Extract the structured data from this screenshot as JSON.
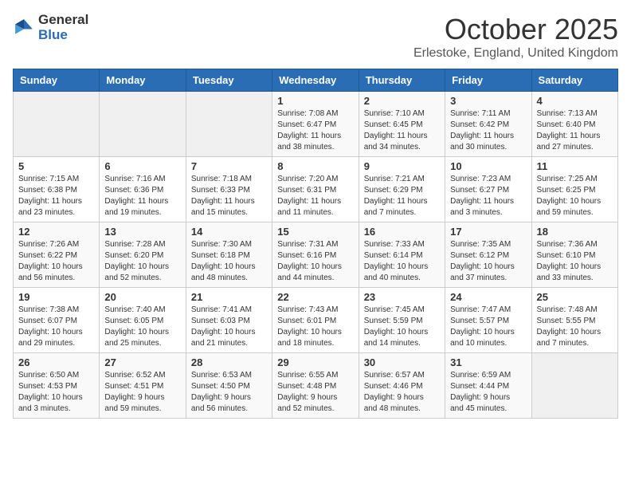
{
  "logo": {
    "general": "General",
    "blue": "Blue"
  },
  "title": "October 2025",
  "location": "Erlestoke, England, United Kingdom",
  "days_of_week": [
    "Sunday",
    "Monday",
    "Tuesday",
    "Wednesday",
    "Thursday",
    "Friday",
    "Saturday"
  ],
  "weeks": [
    [
      {
        "day": "",
        "info": ""
      },
      {
        "day": "",
        "info": ""
      },
      {
        "day": "",
        "info": ""
      },
      {
        "day": "1",
        "info": "Sunrise: 7:08 AM\nSunset: 6:47 PM\nDaylight: 11 hours\nand 38 minutes."
      },
      {
        "day": "2",
        "info": "Sunrise: 7:10 AM\nSunset: 6:45 PM\nDaylight: 11 hours\nand 34 minutes."
      },
      {
        "day": "3",
        "info": "Sunrise: 7:11 AM\nSunset: 6:42 PM\nDaylight: 11 hours\nand 30 minutes."
      },
      {
        "day": "4",
        "info": "Sunrise: 7:13 AM\nSunset: 6:40 PM\nDaylight: 11 hours\nand 27 minutes."
      }
    ],
    [
      {
        "day": "5",
        "info": "Sunrise: 7:15 AM\nSunset: 6:38 PM\nDaylight: 11 hours\nand 23 minutes."
      },
      {
        "day": "6",
        "info": "Sunrise: 7:16 AM\nSunset: 6:36 PM\nDaylight: 11 hours\nand 19 minutes."
      },
      {
        "day": "7",
        "info": "Sunrise: 7:18 AM\nSunset: 6:33 PM\nDaylight: 11 hours\nand 15 minutes."
      },
      {
        "day": "8",
        "info": "Sunrise: 7:20 AM\nSunset: 6:31 PM\nDaylight: 11 hours\nand 11 minutes."
      },
      {
        "day": "9",
        "info": "Sunrise: 7:21 AM\nSunset: 6:29 PM\nDaylight: 11 hours\nand 7 minutes."
      },
      {
        "day": "10",
        "info": "Sunrise: 7:23 AM\nSunset: 6:27 PM\nDaylight: 11 hours\nand 3 minutes."
      },
      {
        "day": "11",
        "info": "Sunrise: 7:25 AM\nSunset: 6:25 PM\nDaylight: 10 hours\nand 59 minutes."
      }
    ],
    [
      {
        "day": "12",
        "info": "Sunrise: 7:26 AM\nSunset: 6:22 PM\nDaylight: 10 hours\nand 56 minutes."
      },
      {
        "day": "13",
        "info": "Sunrise: 7:28 AM\nSunset: 6:20 PM\nDaylight: 10 hours\nand 52 minutes."
      },
      {
        "day": "14",
        "info": "Sunrise: 7:30 AM\nSunset: 6:18 PM\nDaylight: 10 hours\nand 48 minutes."
      },
      {
        "day": "15",
        "info": "Sunrise: 7:31 AM\nSunset: 6:16 PM\nDaylight: 10 hours\nand 44 minutes."
      },
      {
        "day": "16",
        "info": "Sunrise: 7:33 AM\nSunset: 6:14 PM\nDaylight: 10 hours\nand 40 minutes."
      },
      {
        "day": "17",
        "info": "Sunrise: 7:35 AM\nSunset: 6:12 PM\nDaylight: 10 hours\nand 37 minutes."
      },
      {
        "day": "18",
        "info": "Sunrise: 7:36 AM\nSunset: 6:10 PM\nDaylight: 10 hours\nand 33 minutes."
      }
    ],
    [
      {
        "day": "19",
        "info": "Sunrise: 7:38 AM\nSunset: 6:07 PM\nDaylight: 10 hours\nand 29 minutes."
      },
      {
        "day": "20",
        "info": "Sunrise: 7:40 AM\nSunset: 6:05 PM\nDaylight: 10 hours\nand 25 minutes."
      },
      {
        "day": "21",
        "info": "Sunrise: 7:41 AM\nSunset: 6:03 PM\nDaylight: 10 hours\nand 21 minutes."
      },
      {
        "day": "22",
        "info": "Sunrise: 7:43 AM\nSunset: 6:01 PM\nDaylight: 10 hours\nand 18 minutes."
      },
      {
        "day": "23",
        "info": "Sunrise: 7:45 AM\nSunset: 5:59 PM\nDaylight: 10 hours\nand 14 minutes."
      },
      {
        "day": "24",
        "info": "Sunrise: 7:47 AM\nSunset: 5:57 PM\nDaylight: 10 hours\nand 10 minutes."
      },
      {
        "day": "25",
        "info": "Sunrise: 7:48 AM\nSunset: 5:55 PM\nDaylight: 10 hours\nand 7 minutes."
      }
    ],
    [
      {
        "day": "26",
        "info": "Sunrise: 6:50 AM\nSunset: 4:53 PM\nDaylight: 10 hours\nand 3 minutes."
      },
      {
        "day": "27",
        "info": "Sunrise: 6:52 AM\nSunset: 4:51 PM\nDaylight: 9 hours\nand 59 minutes."
      },
      {
        "day": "28",
        "info": "Sunrise: 6:53 AM\nSunset: 4:50 PM\nDaylight: 9 hours\nand 56 minutes."
      },
      {
        "day": "29",
        "info": "Sunrise: 6:55 AM\nSunset: 4:48 PM\nDaylight: 9 hours\nand 52 minutes."
      },
      {
        "day": "30",
        "info": "Sunrise: 6:57 AM\nSunset: 4:46 PM\nDaylight: 9 hours\nand 48 minutes."
      },
      {
        "day": "31",
        "info": "Sunrise: 6:59 AM\nSunset: 4:44 PM\nDaylight: 9 hours\nand 45 minutes."
      },
      {
        "day": "",
        "info": ""
      }
    ]
  ]
}
